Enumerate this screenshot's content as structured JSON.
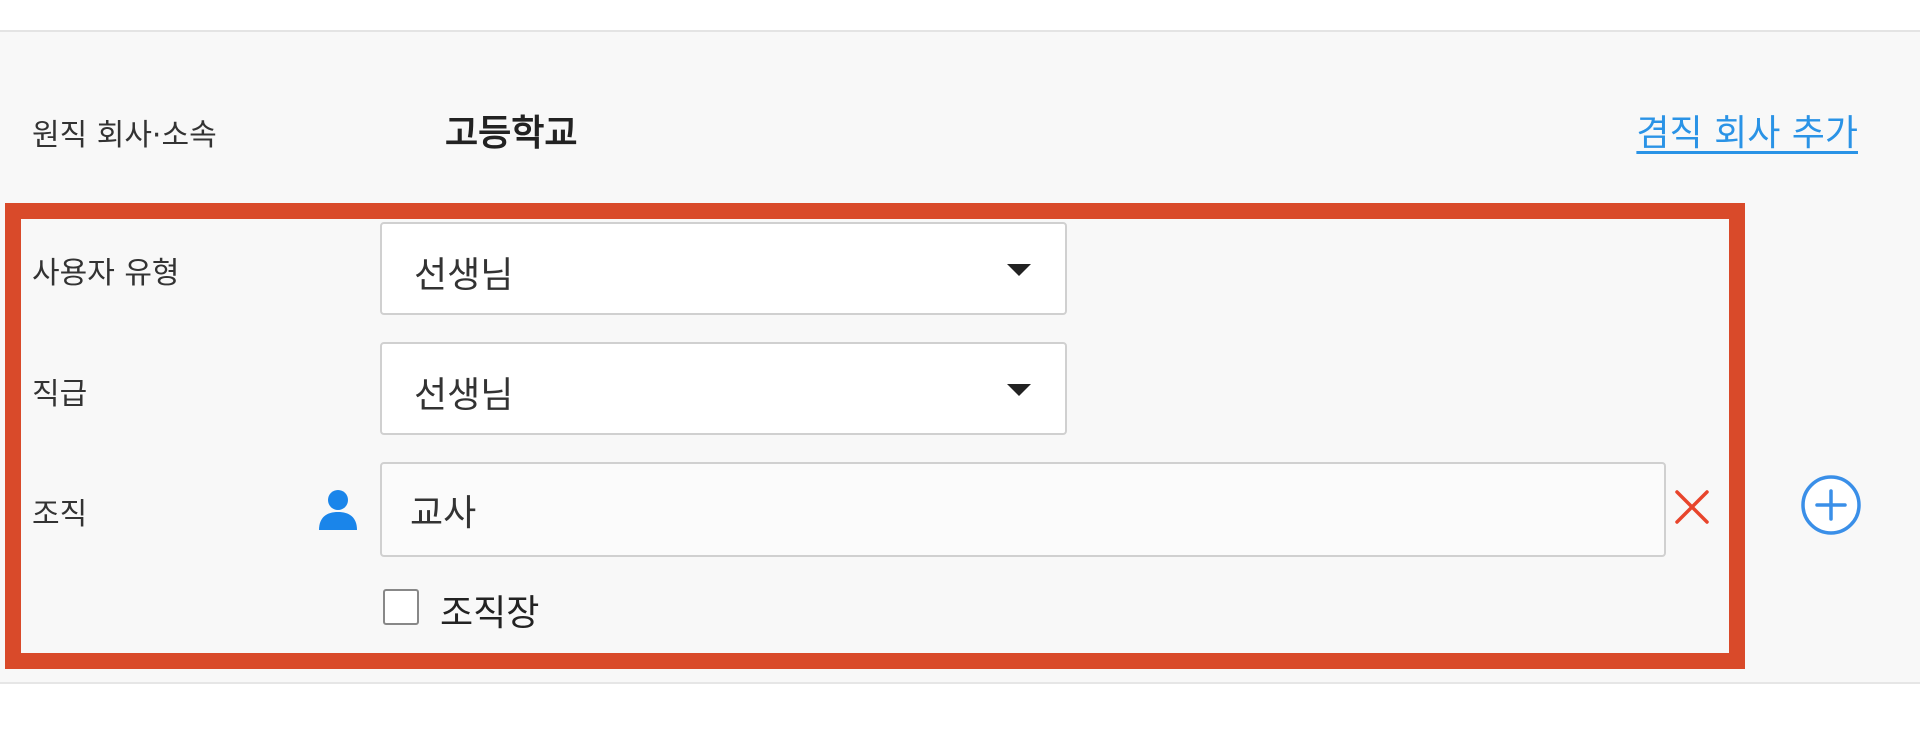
{
  "header": {
    "original_company_label": "원직 회사·소속",
    "company_name": "고등학교",
    "add_concurrent_company_link": "겸직 회사 추가"
  },
  "form": {
    "user_type": {
      "label": "사용자 유형",
      "selected": "선생님"
    },
    "position": {
      "label": "직급",
      "selected": "선생님"
    },
    "organization": {
      "label": "조직",
      "value": "교사",
      "icon": "person-icon",
      "clear_icon": "close-icon",
      "add_icon": "plus-circle-icon"
    },
    "org_head_checkbox": {
      "label": "조직장",
      "checked": false
    }
  },
  "colors": {
    "highlight_border": "#d94a2a",
    "link": "#2a93e6",
    "person_icon": "#1a85ea",
    "clear_icon": "#e8452c",
    "add_icon": "#3a8fe8",
    "panel_bg": "#f8f8f8"
  }
}
